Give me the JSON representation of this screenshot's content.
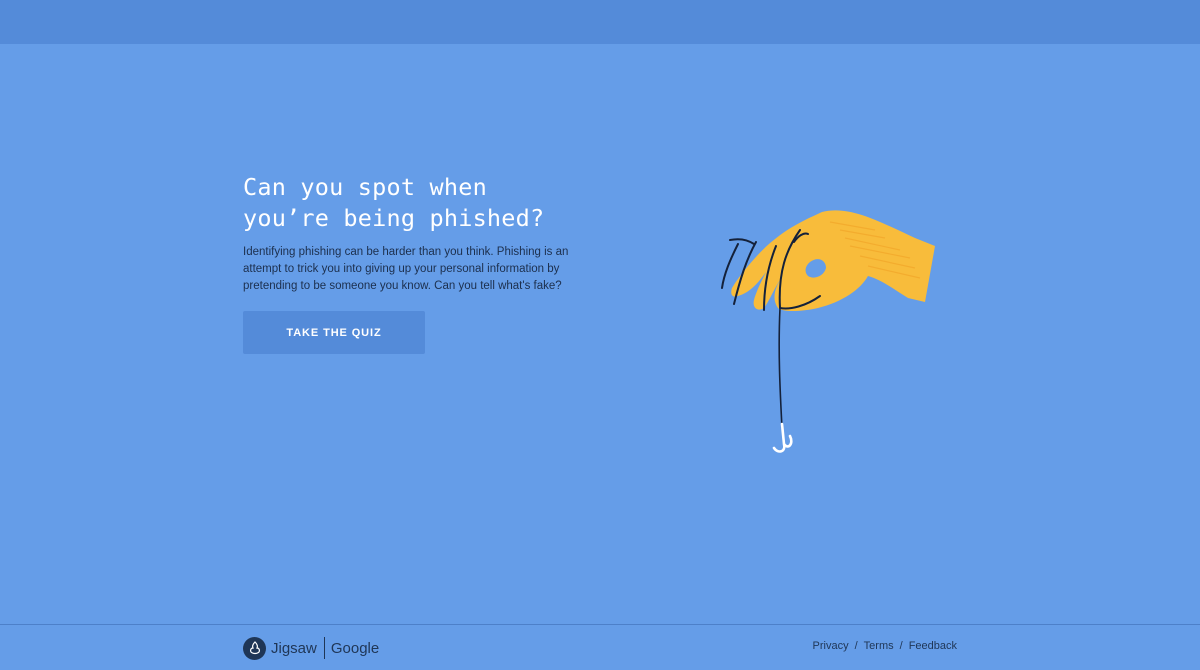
{
  "hero": {
    "title_line1": "Can you spot when",
    "title_line2": "you’re being phished?",
    "description": "Identifying phishing can be harder than you think. Phishing is an attempt to trick you into giving up your personal information by pretending to be someone you know. Can you tell what's fake?",
    "cta_label": "TAKE THE QUIZ"
  },
  "illustration": {
    "subject": "hand-holding-fishing-hook"
  },
  "footer": {
    "brand_jigsaw": "Jigsaw",
    "brand_google": "Google",
    "links": {
      "privacy": "Privacy",
      "terms": "Terms",
      "feedback": "Feedback"
    },
    "separator": "/"
  },
  "colors": {
    "background": "#659de8",
    "topbar": "#548bd9",
    "button": "#548bd9",
    "hand": "#f8bc3b",
    "text_dark": "#1f3656"
  }
}
